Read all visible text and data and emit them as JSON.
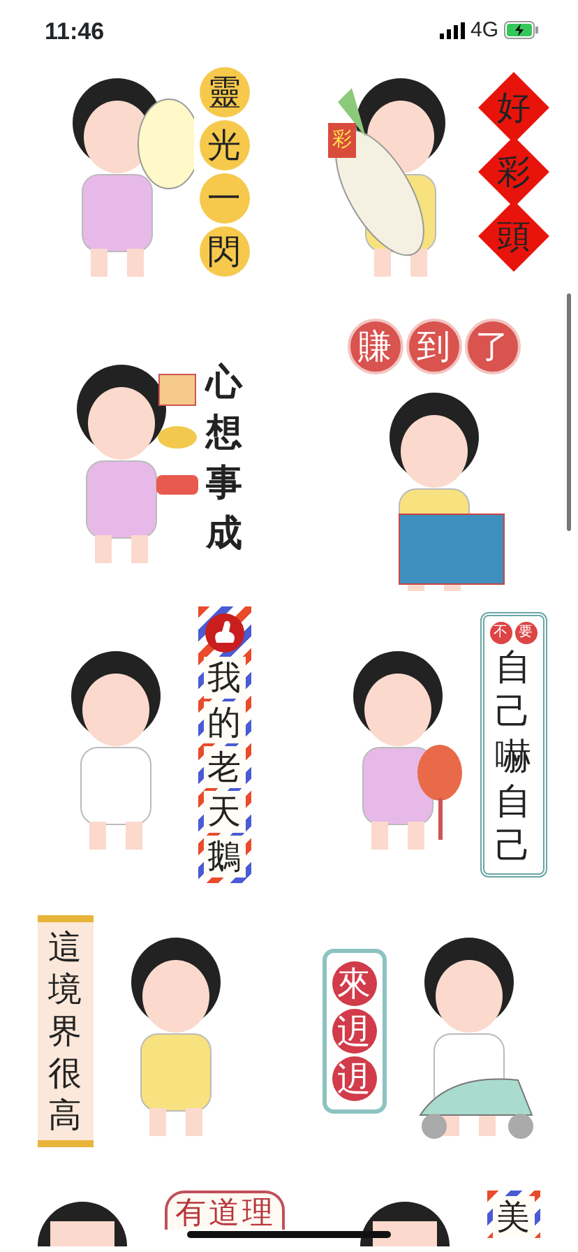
{
  "status_bar": {
    "time": "11:46",
    "network": "4G"
  },
  "stickers": [
    {
      "kind": "bulb",
      "label": [
        "靈",
        "光",
        "一",
        "閃"
      ]
    },
    {
      "kind": "radish",
      "label": [
        "好",
        "彩",
        "頭"
      ],
      "tag": "彩"
    },
    {
      "kind": "gifts",
      "label": [
        "心",
        "想",
        "事",
        "成"
      ]
    },
    {
      "kind": "bag",
      "label": [
        "賺",
        "到",
        "了"
      ]
    },
    {
      "kind": "goose",
      "label": [
        "我",
        "的",
        "老",
        "天",
        "鵝"
      ]
    },
    {
      "kind": "mirror",
      "header": [
        "不",
        "要"
      ],
      "label": [
        "自",
        "己",
        "嚇",
        "自",
        "己"
      ]
    },
    {
      "kind": "scroll",
      "label": [
        "這",
        "境",
        "界",
        "很",
        "高"
      ]
    },
    {
      "kind": "scooter",
      "label": [
        "來",
        "迌",
        "迌"
      ]
    },
    {
      "kind": "reason",
      "label": [
        "有",
        "道",
        "理"
      ]
    },
    {
      "kind": "beauty",
      "label": [
        "美"
      ]
    }
  ]
}
